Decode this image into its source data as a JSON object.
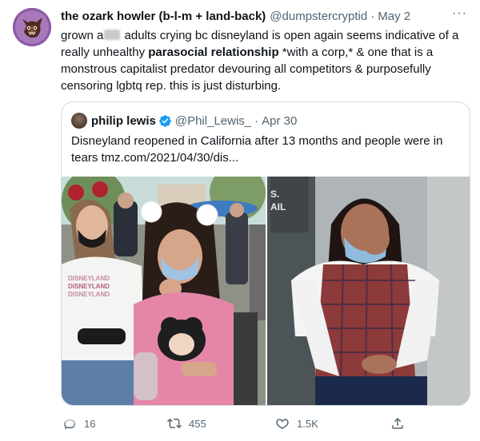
{
  "author": {
    "display_name": "the ozark howler (b-l-m + land-back)",
    "handle": "@dumpstercryptid",
    "date": "May 2"
  },
  "body": {
    "part1": "grown a",
    "part2": " adults crying bc disneyland is open again seems indicative of a really unhealthy ",
    "bold": "parasocial relationship",
    "part3": " *with a corp,* & one that is a monstrous capitalist predator devouring all competitors & purposefully censoring lgbtq rep. this is just disturbing."
  },
  "quote": {
    "name": "philip lewis",
    "handle": "@Phil_Lewis_",
    "date": "Apr 30",
    "text": "Disneyland reopened in California after 13 months and people were in tears tmz.com/2021/04/30/dis...",
    "shirt_text": [
      "DISNEYLAND",
      "DISNEYLAND",
      "DISNEYLAND"
    ],
    "sign_text": [
      "S.",
      "AIL"
    ]
  },
  "actions": {
    "replies": "16",
    "retweets": "455",
    "likes": "1.5K"
  },
  "icons": {
    "more": "more-icon",
    "verified": "verified-badge-icon",
    "reply": "reply-icon",
    "retweet": "retweet-icon",
    "like": "heart-icon",
    "share": "share-icon"
  },
  "colors": {
    "text": "#0f1419",
    "secondary": "#536471",
    "verified": "#1d9bf0",
    "border": "#cfd9de"
  }
}
